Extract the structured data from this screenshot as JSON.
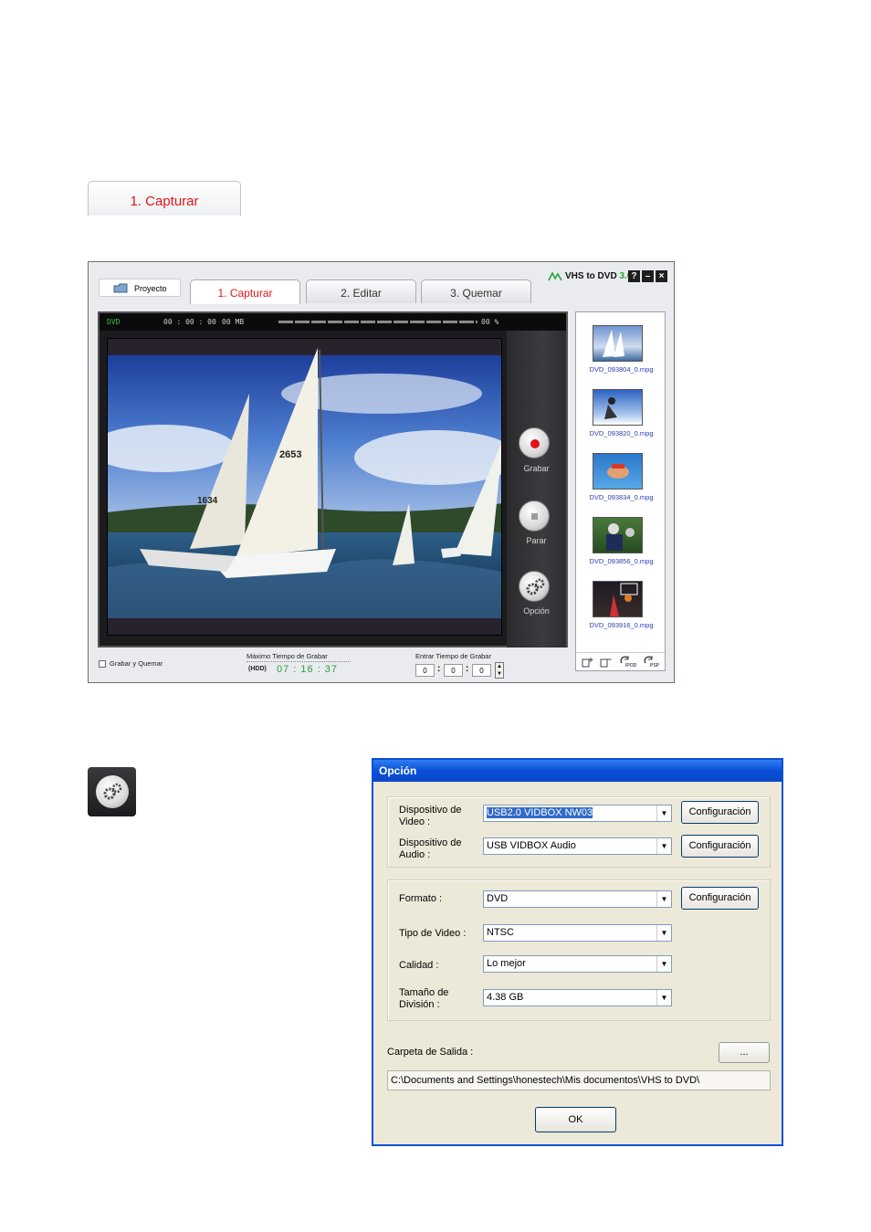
{
  "standalone_tab": {
    "label": "1. Capturar"
  },
  "app": {
    "project_button": "Proyecto",
    "tabs": [
      {
        "label": "1. Capturar"
      },
      {
        "label": "2. Editar"
      },
      {
        "label": "3. Quemar"
      }
    ],
    "brand_name": "VHS to DVD",
    "brand_version": "3.0",
    "window_buttons": {
      "help": "?",
      "minimize": "–",
      "close": "×"
    },
    "status": {
      "format": "DVD",
      "time": "00 : 00 : 00",
      "size": "00 MB",
      "percent": "00 %"
    },
    "controls": {
      "record": "Grabar",
      "stop": "Parar",
      "option": "Opción"
    },
    "thumbnails": [
      {
        "name": "DVD_093804_0.mpg",
        "icon": "sailboat-thumbnail"
      },
      {
        "name": "DVD_093820_0.mpg",
        "icon": "skier-thumbnail"
      },
      {
        "name": "DVD_093834_0.mpg",
        "icon": "swimmer-thumbnail"
      },
      {
        "name": "DVD_093856_0.mpg",
        "icon": "football-thumbnail"
      },
      {
        "name": "DVD_093916_0.mpg",
        "icon": "basketball-thumbnail"
      }
    ],
    "thumb_toolbar": {
      "ipod": "IPOD",
      "psp": "PSP"
    },
    "record_and_burn": "Grabar y Quemar",
    "max_record_label": "Máximo Tiempo de Grabar",
    "hdd_label": "(HDD)",
    "max_record_time": "07 : 16 : 37",
    "enter_time_label": "Entrar Tiempo de Grabar",
    "enter_time": {
      "h": "0",
      "m": "0",
      "s": "0"
    },
    "colors": {
      "accent_red": "#e0161b",
      "brand_green": "#27a33a"
    }
  },
  "dialog": {
    "title": "Opción",
    "video_device_label": "Dispositivo de Video :",
    "video_device_value": "USB2.0 VIDBOX NW03",
    "audio_device_label": "Dispositivo de Audio :",
    "audio_device_value": "USB VIDBOX Audio",
    "format_label": "Formato :",
    "format_value": "DVD",
    "video_type_label": "Tipo de Video :",
    "video_type_value": "NTSC",
    "quality_label": "Calidad :",
    "quality_value": "Lo mejor",
    "split_size_label": "Tamaño de División :",
    "split_size_value": "4.38 GB",
    "config_button": "Configuración",
    "output_folder_label": "Carpeta de Salida :",
    "browse_button": "...",
    "output_path": "C:\\Documents and Settings\\honestech\\Mis documentos\\VHS to DVD\\",
    "ok_button": "OK",
    "colors": {
      "title_bar": "#0a4fd9",
      "face": "#ece9d8"
    }
  }
}
